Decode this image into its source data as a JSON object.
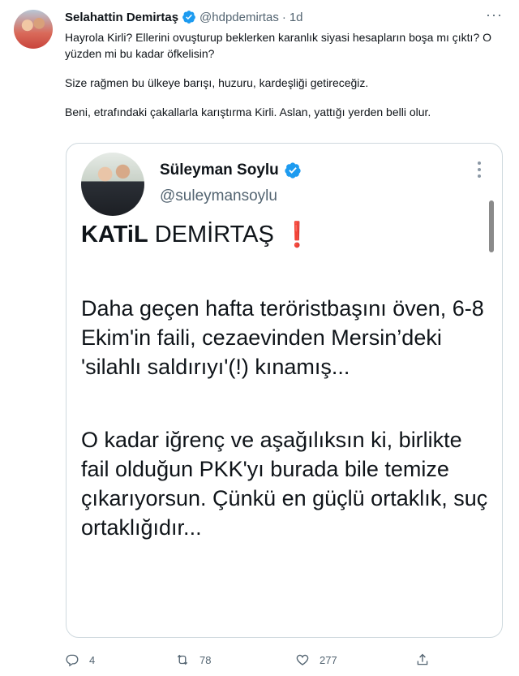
{
  "tweet": {
    "author_name": "Selahattin Demirtaş",
    "author_handle": "@hdpdemirtas",
    "separator": "·",
    "time": "1d",
    "more": "···",
    "paragraphs": [
      "Hayrola Kirli? Ellerini ovuşturup beklerken karanlık siyasi hesapların boşa mı çıktı? O yüzden mi bu kadar öfkelisin?",
      "Size rağmen bu ülkeye barışı, huzuru, kardeşliği getireceğiz.",
      "Beni, etrafındaki çakallarla karıştırma Kirli. Aslan, yattığı yerden belli olur."
    ]
  },
  "quote": {
    "author_name": "Süleyman Soylu",
    "author_handle": "@suleymansoylu",
    "title_bold": "KATiL",
    "title_rest": "DEMİRTAŞ",
    "title_mark": "❗",
    "paragraphs": [
      "Daha geçen hafta teröristbaşını öven, 6-8 Ekim'in faili, cezaevinden Mersin’deki 'silahlı saldırıyı'(!) kınamış...",
      "O kadar iğrenç ve aşağılıksın ki, birlikte fail olduğun PKK'yı burada bile temize çıkarıyorsun. Çünkü en güçlü ortaklık, suç ortaklığıdır..."
    ]
  },
  "actions": {
    "reply_count": "4",
    "retweet_count": "78",
    "like_count": "277"
  },
  "colors": {
    "verified": "#1d9bf0",
    "secondary_text": "#536471",
    "border": "#cfd9de",
    "exclamation": "#d9232e"
  },
  "icons": [
    "verified-badge-icon",
    "more-icon",
    "reply-icon",
    "retweet-icon",
    "like-icon",
    "share-icon"
  ]
}
